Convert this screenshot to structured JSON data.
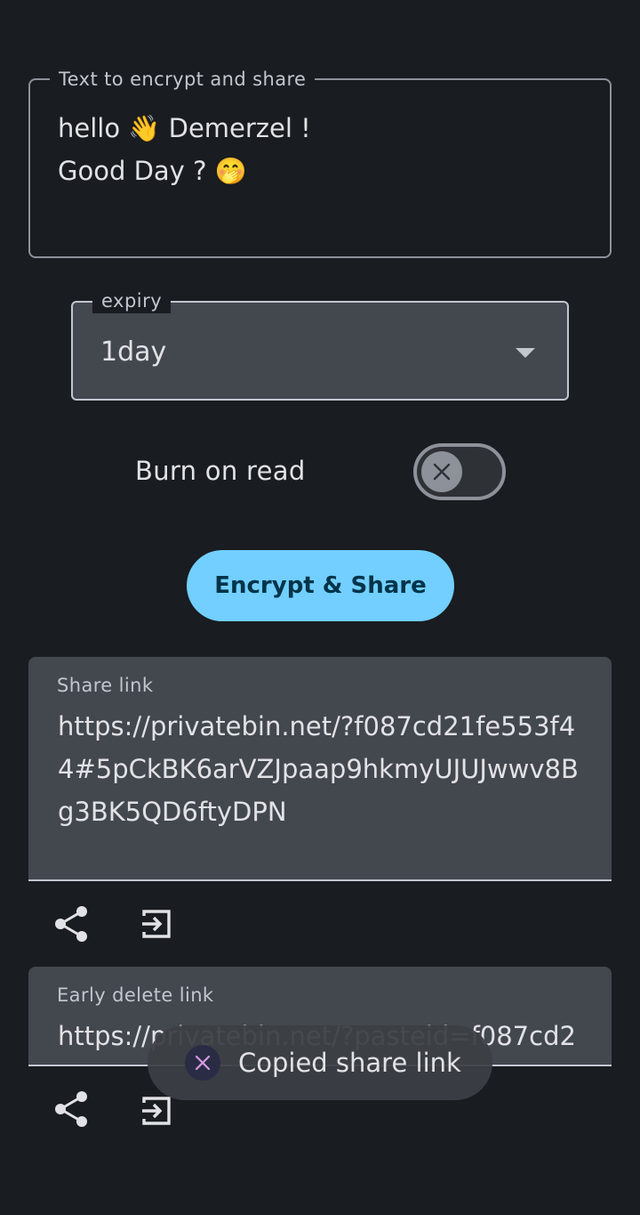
{
  "message_field": {
    "label": "Text to encrypt and share",
    "value": "hello 👋 Demerzel !\nGood Day ? 🤭"
  },
  "expiry": {
    "label": "expiry",
    "selected": "1day"
  },
  "burn_on_read": {
    "label": "Burn on read",
    "enabled": false
  },
  "encrypt_button": {
    "label": "Encrypt & Share"
  },
  "share_link": {
    "label": "Share link",
    "value": "https://privatebin.net/?f087cd21fe553f44#5pCkBK6arVZJpaap9hkmyUJUJwwv8Bg3BK5QD6ftyDPN"
  },
  "delete_link": {
    "label": "Early delete link",
    "value": "https://privatebin.net/?pasteid=f087cd2"
  },
  "toast": {
    "message": "Copied share link"
  },
  "icons": {
    "share": "share-icon",
    "open": "exit-to-app-icon",
    "switch_off": "close-icon",
    "toast_app": "app-logo-icon"
  },
  "colors": {
    "background": "#191c20",
    "field_fill": "#43474e",
    "accent_button": "#72cfff",
    "accent_button_text": "#00344a",
    "outline": "#8d9199"
  }
}
